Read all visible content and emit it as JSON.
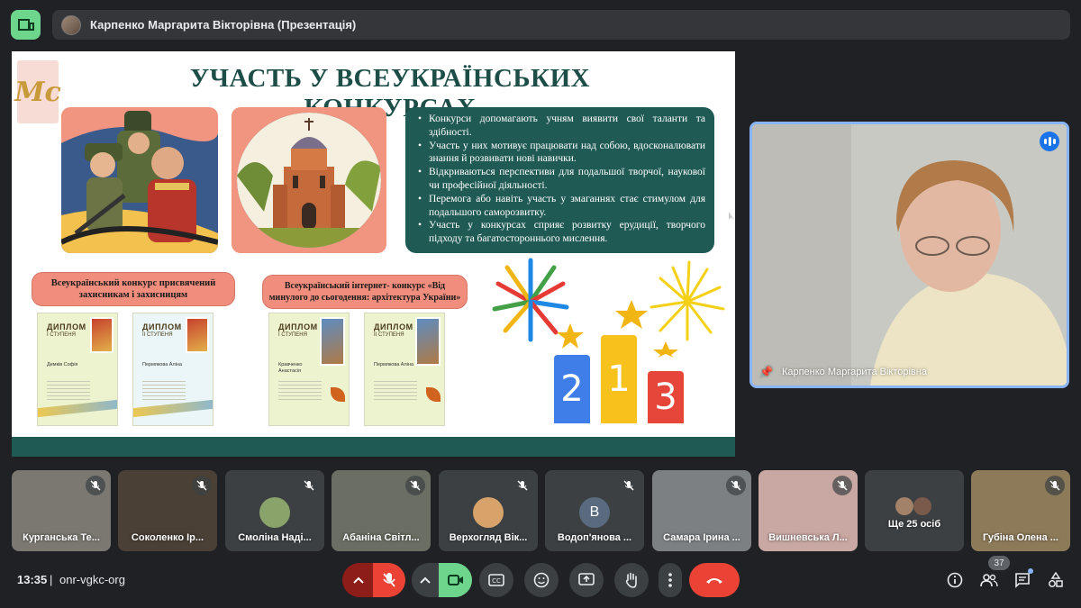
{
  "top": {
    "presenter_title": "Карпенко Маргарита Вікторівна (Презентація)"
  },
  "slide": {
    "logo_text": "Mc",
    "title": "УЧАСТЬ У ВСЕУКРАЇНСЬКИХ КОНКУРСАХ",
    "bullets": [
      "Конкурси допомагають учням виявити свої таланти та здібності.",
      "Участь у них мотивує працювати над собою, вдосконалювати знання й розвивати нові навички.",
      "Відкриваються перспективи для подальшої творчої, наукової чи професійної діяльності.",
      "Перемога або навіть участь у змаганнях стає стимулом для подальшого саморозвитку.",
      "Участь у конкурсах сприяє розвитку ерудиції, творчого підходу та багатостороннього мислення."
    ],
    "contest1": "Всеукраїнський конкурс присвячений захисникам і захисницям",
    "contest2": "Всеукраїнський інтернет- конкурс «Від минулого до сьогодення: архітектура України»",
    "diplomas": [
      {
        "title": "ДИПЛОМ",
        "degree": "І СТУПЕНЯ",
        "name": "Демків Софія"
      },
      {
        "title": "ДИПЛОМ",
        "degree": "ІІ СТУПЕНЯ",
        "name": "Пермякова Аліна"
      },
      {
        "title": "ДИПЛОМ",
        "degree": "І СТУПЕНЯ",
        "name": "Кравченко Анастасія"
      },
      {
        "title": "ДИПЛОМ",
        "degree": "ІІ СТУПЕНЯ",
        "name": "Пермякова Аліна"
      }
    ],
    "podium": [
      "2",
      "1",
      "3"
    ]
  },
  "speaker": {
    "name": "Карпенко Маргарита Вікторівна"
  },
  "participants": [
    {
      "name": "Курганська Те..."
    },
    {
      "name": "Соколенко Ір..."
    },
    {
      "name": "Смоліна Наді..."
    },
    {
      "name": "Абаніна Світл..."
    },
    {
      "name": "Верхогляд Вік..."
    },
    {
      "name": "Водоп'янова ...",
      "initial": "В"
    },
    {
      "name": "Самара Ірина ..."
    },
    {
      "name": "Вишневська Л..."
    },
    {
      "name": "Ще 25 осіб"
    },
    {
      "name": "Губіна Олена ..."
    }
  ],
  "bottom": {
    "time": "13:35",
    "separator": "|",
    "meeting_code": "onr-vgkc-org",
    "participant_count": "37"
  },
  "colors": {
    "accent_blue": "#8ab4f8",
    "danger_red": "#ea4335",
    "camera_green": "#6dd58c",
    "slide_teal": "#1f5a55",
    "slide_coral": "#f19581"
  }
}
